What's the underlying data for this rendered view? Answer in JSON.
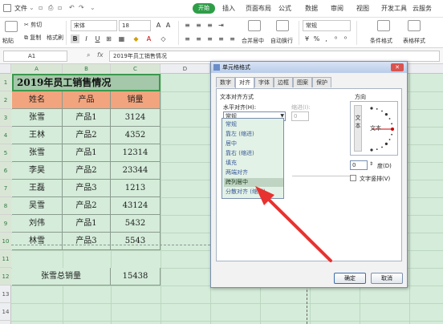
{
  "menubar": {
    "file_label": "文件",
    "tabs": [
      "开始",
      "插入",
      "页面布局",
      "公式",
      "数据",
      "审阅",
      "视图",
      "开发工具",
      "云服务"
    ]
  },
  "ribbon": {
    "paste_label": "粘贴",
    "cut_label": "剪切",
    "copy_label": "复制",
    "format_painter_label": "格式刷",
    "font_name": "宋体",
    "font_size": "18",
    "merge_label": "合并居中",
    "wrap_label": "自动换行",
    "number_format": "常规",
    "cond_format_label": "条件格式",
    "table_style_label": "表格样式"
  },
  "formula_bar": {
    "cell_ref": "A1",
    "fx_label": "fx",
    "formula": "2019年员工销售情况"
  },
  "sheet": {
    "columns": [
      "A",
      "B",
      "C",
      "D"
    ],
    "rows": [
      "1",
      "2",
      "3",
      "4",
      "5",
      "6",
      "7",
      "8",
      "9",
      "10",
      "11",
      "12",
      "13",
      "14"
    ],
    "title": "2019年员工销售情况",
    "headers": [
      "姓名",
      "产品",
      "销量"
    ],
    "data": [
      [
        "张雪",
        "产品1",
        "3124"
      ],
      [
        "王林",
        "产品2",
        "4352"
      ],
      [
        "张雪",
        "产品1",
        "12314"
      ],
      [
        "李昊",
        "产品2",
        "23344"
      ],
      [
        "王磊",
        "产品3",
        "1213"
      ],
      [
        "吴雪",
        "产品2",
        "43124"
      ],
      [
        "刘伟",
        "产品1",
        "5432"
      ],
      [
        "林雪",
        "产品3",
        "5543"
      ]
    ],
    "summary_label": "张雪总销量",
    "summary_value": "15438"
  },
  "dialog": {
    "title": "单元格格式",
    "close_label": "✕",
    "tabs": [
      "数字",
      "对齐",
      "字体",
      "边框",
      "图案",
      "保护"
    ],
    "active_tab": "对齐",
    "section_text_align": "文本对齐方式",
    "horizontal_label": "水平对齐(H):",
    "horizontal_value": "常规",
    "indent_label": "缩进(I):",
    "indent_value": "0",
    "horizontal_options": [
      "常规",
      "靠左 (缩进)",
      "居中",
      "靠右 (缩进)",
      "填充",
      "两端对齐",
      "跨列居中",
      "分散对齐 (缩进)"
    ],
    "selected_option": "跨列居中",
    "direction_label": "方向",
    "vertical_text": "文本",
    "orient_text": "文本",
    "degree_value": "0",
    "degree_label": "度(D)",
    "rtl_label": "文字竖排(V)",
    "ok_label": "确定",
    "cancel_label": "取消"
  },
  "colors": {
    "accent_green": "#2e9e48",
    "header_fill": "#f2a47e",
    "sheet_fill": "#d4ecd9",
    "arrow_red": "#e8322f"
  }
}
